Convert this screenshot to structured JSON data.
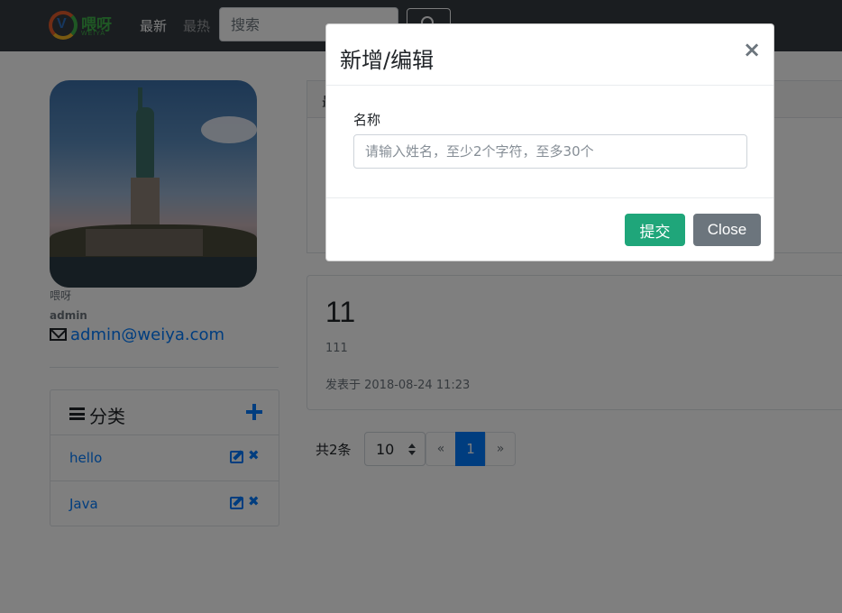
{
  "navbar": {
    "logo_text": "喂呀",
    "logo_sub": "WEIYA",
    "logo_mark": "V",
    "links": [
      "最新",
      "最热"
    ],
    "search_placeholder": "搜索"
  },
  "profile": {
    "site_name": "喂呀",
    "username": "admin",
    "email": "admin@weiya.com"
  },
  "categories": {
    "title": "分类",
    "items": [
      {
        "label": "hello"
      },
      {
        "label": "Java"
      }
    ]
  },
  "posts": {
    "tab_label": "最",
    "items": [
      {
        "title": "11",
        "body": "111",
        "date": "发表于 2018-08-24 11:23"
      }
    ]
  },
  "pagination": {
    "total": "共2条",
    "page_size": "10",
    "prev": "«",
    "current": "1",
    "next": "»"
  },
  "modal": {
    "title": "新增/编辑",
    "close_glyph": "×",
    "field_label": "名称",
    "field_placeholder": "请输入姓名，至少2个字符，至多30个",
    "submit_label": "提交",
    "close_label": "Close"
  },
  "colors": {
    "primary": "#007bff",
    "navbar": "#343a40",
    "submit": "#1fa67a",
    "secondary": "#6c757d"
  }
}
